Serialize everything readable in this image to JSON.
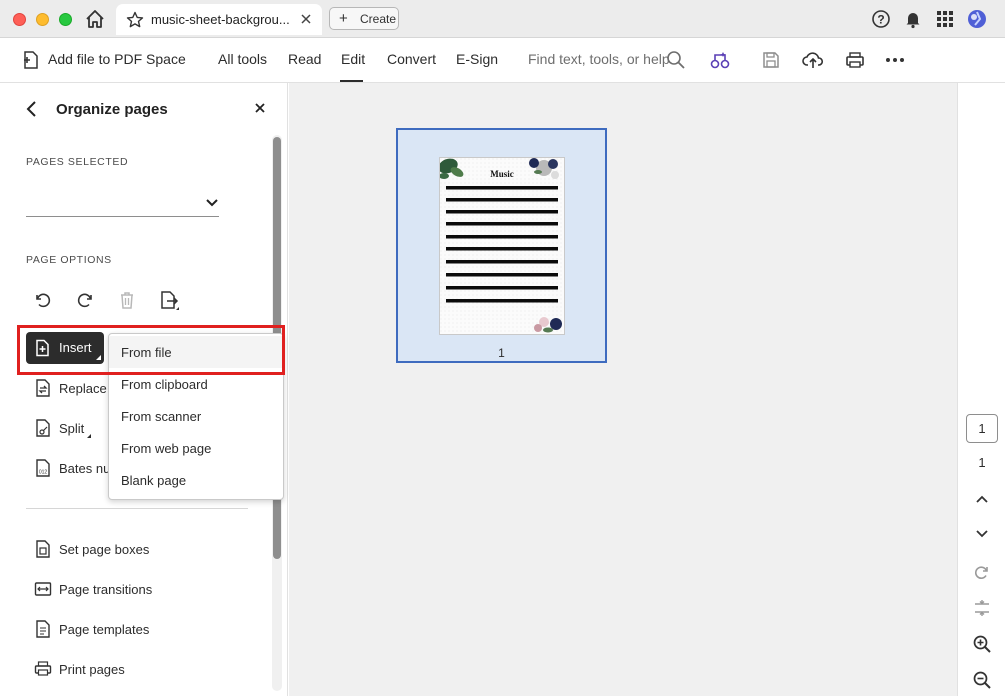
{
  "titlebar": {
    "tab_title": "music-sheet-backgrou...",
    "create_label": "Create"
  },
  "toolbar": {
    "add_file_label": "Add file to PDF Space",
    "menu": [
      "All tools",
      "Read",
      "Edit",
      "Convert",
      "E-Sign"
    ],
    "active_menu": "Edit",
    "search_placeholder": "Find text, tools, or help"
  },
  "left_panel": {
    "title": "Organize pages",
    "pages_selected_label": "PAGES SELECTED",
    "page_options_label": "PAGE OPTIONS",
    "insert_label": "Insert",
    "rows": [
      "Replace",
      "Split",
      "Bates nu"
    ],
    "more_rows": [
      "Set page boxes",
      "Page transitions",
      "Page templates",
      "Print pages"
    ]
  },
  "insert_menu": {
    "items": [
      "From file",
      "From clipboard",
      "From scanner",
      "From web page",
      "Blank page"
    ],
    "highlighted": "From file"
  },
  "document": {
    "page_title": "Music",
    "page_number_label": "1"
  },
  "right_rail": {
    "current_page": "1",
    "total_pages": "1"
  },
  "colors": {
    "selection_frame": "#3e6bbf",
    "selection_fill": "#dae6f5",
    "highlight_box": "#e0201f",
    "insert_button": "#2c2c2c"
  }
}
